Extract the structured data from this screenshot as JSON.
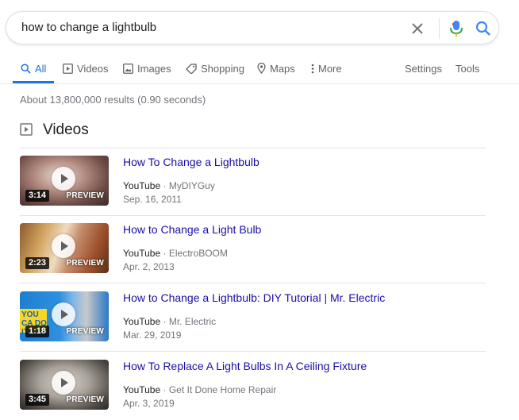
{
  "search": {
    "query": "how to change a lightbulb"
  },
  "tabs": [
    {
      "label": "All",
      "icon": "search-icon",
      "active": true
    },
    {
      "label": "Videos",
      "icon": "video-icon"
    },
    {
      "label": "Images",
      "icon": "image-icon"
    },
    {
      "label": "Shopping",
      "icon": "tag-icon"
    },
    {
      "label": "Maps",
      "icon": "map-pin-icon"
    },
    {
      "label": "More",
      "icon": "more-vert-icon"
    }
  ],
  "tools": {
    "settings": "Settings",
    "tools": "Tools"
  },
  "stats": "About 13,800,000 results (0.90 seconds)",
  "videos": {
    "heading": "Videos",
    "items": [
      {
        "title": "How To Change a Lightbulb",
        "source": "YouTube",
        "channel": "MyDIYGuy",
        "date": "Sep. 16, 2011",
        "duration": "3:14",
        "preview": "PREVIEW"
      },
      {
        "title": "How to Change a Light Bulb",
        "source": "YouTube",
        "channel": "ElectroBOOM",
        "date": "Apr. 2, 2013",
        "duration": "2:23",
        "preview": "PREVIEW"
      },
      {
        "title": "How to Change a Lightbulb: DIY Tutorial | Mr. Electric",
        "source": "YouTube",
        "channel": "Mr. Electric",
        "date": "Mar. 29, 2019",
        "duration": "1:18",
        "preview": "PREVIEW",
        "thumb_text": "YOU CA DO IT!"
      },
      {
        "title": "How To Replace A Light Bulbs In A Ceiling Fixture",
        "source": "YouTube",
        "channel": "Get It Done Home Repair",
        "date": "Apr. 3, 2019",
        "duration": "3:45",
        "preview": "PREVIEW"
      }
    ]
  },
  "colors": {
    "accent": "#1a73e8",
    "link": "#1a0dab",
    "muted": "#70757a",
    "mic_red": "#ea4335"
  }
}
